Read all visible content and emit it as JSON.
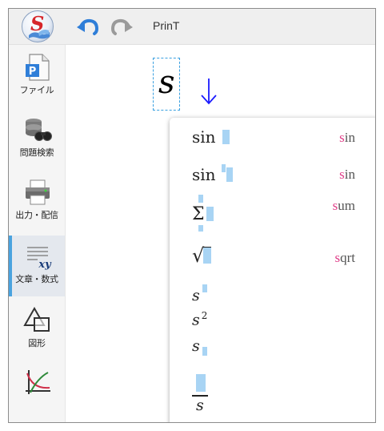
{
  "app": {
    "title": "PrinT"
  },
  "toolbar": {
    "logo_letter": "S",
    "undo_icon": "undo-icon",
    "redo_icon": "redo-icon"
  },
  "sidebar": {
    "items": [
      {
        "label": "ファイル",
        "icon": "file-icon",
        "badge": "P"
      },
      {
        "label": "問題検索",
        "icon": "search-database-icon"
      },
      {
        "label": "出力・配信",
        "icon": "printer-icon"
      },
      {
        "label": "文章・数式",
        "icon": "text-formula-icon",
        "badge": "xy",
        "active": true
      },
      {
        "label": "図形",
        "icon": "shapes-icon"
      },
      {
        "label": "",
        "icon": "graph-icon"
      }
    ]
  },
  "editor": {
    "input_text": "s",
    "arrow": "↓"
  },
  "autocomplete": {
    "items": [
      {
        "name": "sin",
        "display": "sin",
        "key_prefix": "s",
        "key_rest": "in"
      },
      {
        "name": "sin-power",
        "display": "sin",
        "key_prefix": "s",
        "key_rest": "in"
      },
      {
        "name": "sum",
        "display": "Σ",
        "key_prefix": "s",
        "key_rest": "um"
      },
      {
        "name": "sqrt",
        "display": "√",
        "key_prefix": "s",
        "key_rest": "qrt"
      },
      {
        "name": "s-superscript",
        "display": "s"
      },
      {
        "name": "s-squared",
        "display": "s",
        "exponent": "2"
      },
      {
        "name": "s-subscript",
        "display": "s"
      },
      {
        "name": "fraction-over-s",
        "display": "s"
      }
    ]
  },
  "colors": {
    "accent": "#4aa3df",
    "placeholder": "#a8d4f4",
    "highlight": "#e0408a",
    "arrow": "#1a1aff"
  }
}
